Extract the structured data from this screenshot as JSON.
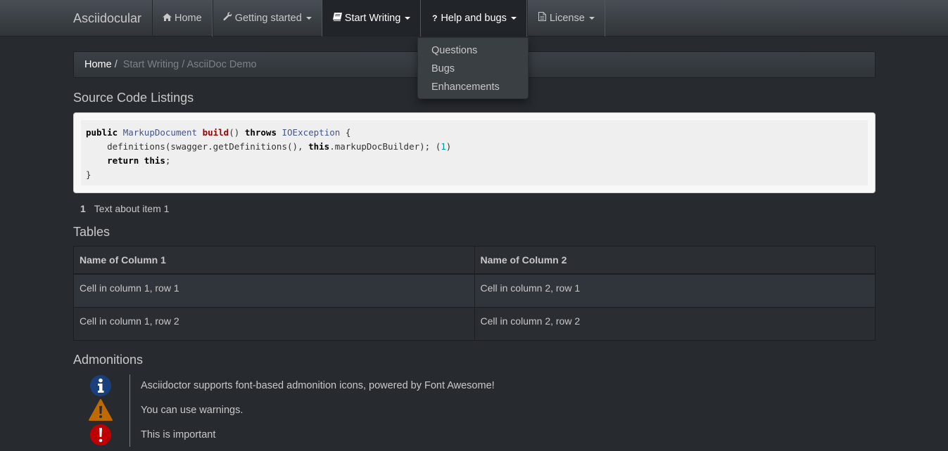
{
  "navbar": {
    "brand": "Asciidocular",
    "items": [
      {
        "label": "Home",
        "icon": "home-icon"
      },
      {
        "label": "Getting started",
        "icon": "wrench-icon"
      },
      {
        "label": "Start Writing",
        "icon": "book-icon"
      },
      {
        "label": "Help and bugs",
        "icon": "question-icon"
      },
      {
        "label": "License",
        "icon": "file-icon"
      }
    ]
  },
  "dropdown": {
    "items": [
      "Questions",
      "Bugs",
      "Enhancements"
    ]
  },
  "breadcrumb": {
    "home": "Home",
    "separator": "/",
    "rest": "Start Writing / AsciiDoc Demo"
  },
  "sections": {
    "source_title": "Source Code Listings",
    "tables_title": "Tables",
    "admonitions_title": "Admonitions"
  },
  "code": {
    "line1": {
      "kw1": "public",
      "type": "MarkupDocument",
      "fn": "build",
      "paren": "()",
      "kw2": "throws",
      "exc": "IOException",
      "brace": "{"
    },
    "line2": {
      "call": "definitions(swagger.getDefinitions(), ",
      "kw": "this",
      "rest": ".markupDocBuilder); (",
      "num": "1",
      "end": ")"
    },
    "line3": {
      "kw1": "return",
      "kw2": "this",
      "end": ";"
    },
    "line4": {
      "brace": "}"
    }
  },
  "callout": {
    "number": "1",
    "text": "Text about item 1"
  },
  "table": {
    "headers": [
      "Name of Column 1",
      "Name of Column 2"
    ],
    "rows": [
      [
        "Cell in column 1, row 1",
        "Cell in column 2, row 1"
      ],
      [
        "Cell in column 1, row 2",
        "Cell in column 2, row 2"
      ]
    ]
  },
  "admonitions": [
    {
      "icon": "info-icon",
      "color": "#19407c",
      "text": "Asciidoctor supports font-based admonition icons, powered by Font Awesome!"
    },
    {
      "icon": "warning-icon",
      "color": "#bf6900",
      "text": "You can use warnings."
    },
    {
      "icon": "important-icon",
      "color": "#bf0000",
      "text": "This is important"
    }
  ],
  "colors": {
    "background": "#272b30",
    "navbar": "#3a3f44",
    "text": "#c8c8c8",
    "muted": "#7a8288"
  }
}
